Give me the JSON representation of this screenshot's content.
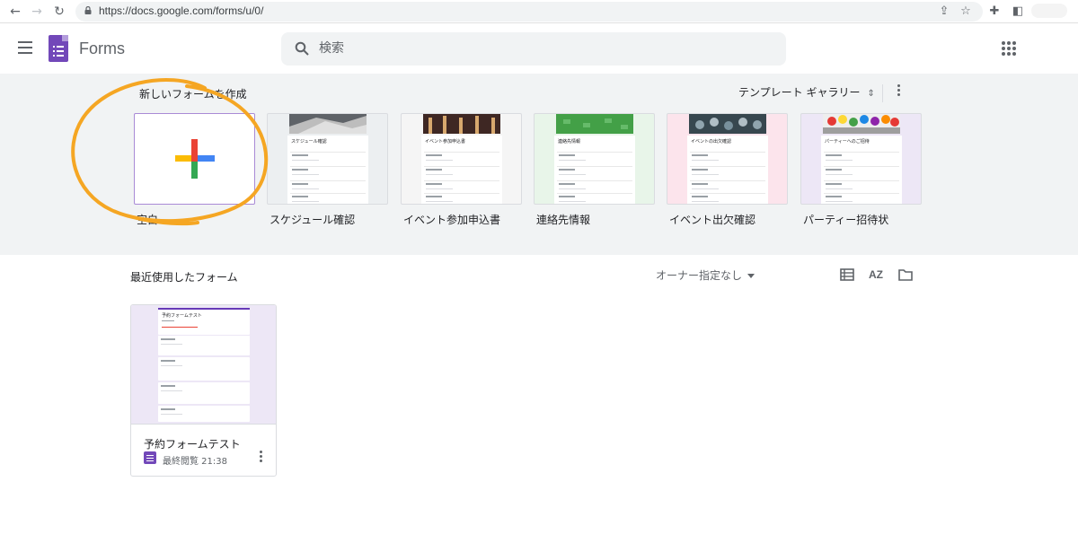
{
  "browser": {
    "url": "https://docs.google.com/forms/u/0/"
  },
  "app": {
    "title": "Forms",
    "search_placeholder": "検索",
    "brand_color": "#7248b9"
  },
  "new_form": {
    "section_title": "新しいフォームを作成",
    "gallery_label": "テンプレート ギャラリー",
    "templates": [
      {
        "label": "空白"
      },
      {
        "label": "スケジュール確認",
        "doc_title": "スケジュール確認"
      },
      {
        "label": "イベント参加申込書",
        "doc_title": "イベント参加申込書"
      },
      {
        "label": "連絡先情報",
        "doc_title": "連絡先情報"
      },
      {
        "label": "イベント出欠確認",
        "doc_title": "イベントの出欠確認"
      },
      {
        "label": "パーティー招待状",
        "doc_title": "パーティーへのご招待"
      }
    ]
  },
  "recent": {
    "section_title": "最近使用したフォーム",
    "owner_filter": "オーナー指定なし",
    "sort_icon": "AZ",
    "forms": [
      {
        "name": "予約フォームテスト",
        "thumb_title": "予約フォームテスト",
        "meta": "最終閲覧 21:38"
      }
    ]
  },
  "annotation": {
    "color": "#f5a623"
  }
}
